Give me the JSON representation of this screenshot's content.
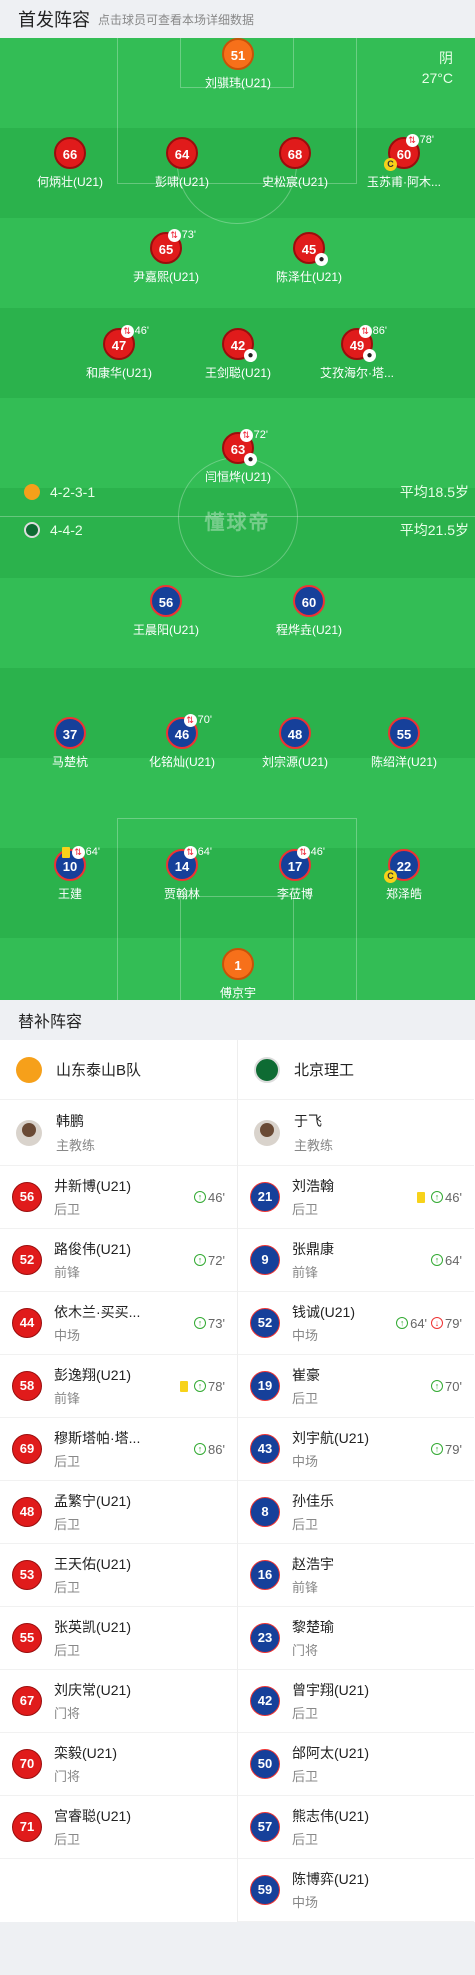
{
  "starting": {
    "title": "首发阵容",
    "subtitle": "点击球员可查看本场详细数据",
    "weather": "阴",
    "temp": "27°C",
    "watermark": "懂球帝"
  },
  "home_team": {
    "formation": "4-2-3-1",
    "avg_age": "平均18.5岁"
  },
  "away_team": {
    "formation": "4-4-2",
    "avg_age": "平均21.5岁"
  },
  "pitch_home": [
    {
      "num": "51",
      "name": "刘骐玮(U21)"
    },
    {
      "num": "66",
      "name": "何炳壮(U21)"
    },
    {
      "num": "64",
      "name": "彭啸(U21)"
    },
    {
      "num": "68",
      "name": "史松宸(U21)"
    },
    {
      "num": "60",
      "name": "玉苏甫·阿木...",
      "sub": "78'",
      "cap": true
    },
    {
      "num": "65",
      "name": "尹嘉熙(U21)",
      "sub": "73'"
    },
    {
      "num": "45",
      "name": "陈泽仕(U21)",
      "ball": true
    },
    {
      "num": "47",
      "name": "和康华(U21)",
      "sub": "46'"
    },
    {
      "num": "42",
      "name": "王剑聪(U21)",
      "ball": true
    },
    {
      "num": "49",
      "name": "艾孜海尔·塔...",
      "sub": "86'",
      "ball": true
    },
    {
      "num": "63",
      "name": "闫恒烨(U21)",
      "sub": "72'",
      "ball": true
    }
  ],
  "pitch_away": [
    {
      "num": "56",
      "name": "王晨阳(U21)"
    },
    {
      "num": "60",
      "name": "程烨垚(U21)"
    },
    {
      "num": "37",
      "name": "马楚杭"
    },
    {
      "num": "46",
      "name": "化铭灿(U21)",
      "sub": "70'"
    },
    {
      "num": "48",
      "name": "刘宗源(U21)"
    },
    {
      "num": "55",
      "name": "陈绍洋(U21)"
    },
    {
      "num": "10",
      "name": "王建",
      "sub": "64'",
      "ycard": true
    },
    {
      "num": "14",
      "name": "贾翰林",
      "sub": "64'"
    },
    {
      "num": "17",
      "name": "李莅博",
      "sub": "46'"
    },
    {
      "num": "22",
      "name": "郑泽皓",
      "cap": true
    },
    {
      "num": "1",
      "name": "傅京宇"
    }
  ],
  "bench": {
    "title": "替补阵容",
    "home": {
      "team": "山东泰山B队",
      "coach": "韩鹏",
      "coach_role": "主教练",
      "players": [
        {
          "num": "56",
          "name": "井新博(U21)",
          "pos": "后卫",
          "in": "46'"
        },
        {
          "num": "52",
          "name": "路俊伟(U21)",
          "pos": "前锋",
          "in": "72'"
        },
        {
          "num": "44",
          "name": "依木兰·买买...",
          "pos": "中场",
          "in": "73'"
        },
        {
          "num": "58",
          "name": "彭逸翔(U21)",
          "pos": "前锋",
          "in": "78'",
          "ycard": true
        },
        {
          "num": "69",
          "name": "穆斯塔帕·塔...",
          "pos": "后卫",
          "in": "86'"
        },
        {
          "num": "48",
          "name": "孟繁宁(U21)",
          "pos": "后卫"
        },
        {
          "num": "53",
          "name": "王天佑(U21)",
          "pos": "后卫"
        },
        {
          "num": "55",
          "name": "张英凯(U21)",
          "pos": "后卫"
        },
        {
          "num": "67",
          "name": "刘庆常(U21)",
          "pos": "门将"
        },
        {
          "num": "70",
          "name": "栾毅(U21)",
          "pos": "门将"
        },
        {
          "num": "71",
          "name": "宫睿聪(U21)",
          "pos": "后卫"
        }
      ]
    },
    "away": {
      "team": "北京理工",
      "coach": "于飞",
      "coach_role": "主教练",
      "players": [
        {
          "num": "21",
          "name": "刘浩翰",
          "pos": "后卫",
          "in": "46'",
          "ycard": true
        },
        {
          "num": "9",
          "name": "张鼎康",
          "pos": "前锋",
          "in": "64'"
        },
        {
          "num": "52",
          "name": "钱诚(U21)",
          "pos": "中场",
          "in": "64'",
          "out": "79'"
        },
        {
          "num": "19",
          "name": "崔豪",
          "pos": "后卫",
          "in": "70'"
        },
        {
          "num": "43",
          "name": "刘宇航(U21)",
          "pos": "中场",
          "in": "79'"
        },
        {
          "num": "8",
          "name": "孙佳乐",
          "pos": "后卫"
        },
        {
          "num": "16",
          "name": "赵浩宇",
          "pos": "前锋"
        },
        {
          "num": "23",
          "name": "黎楚瑜",
          "pos": "门将"
        },
        {
          "num": "42",
          "name": "曾宇翔(U21)",
          "pos": "后卫"
        },
        {
          "num": "50",
          "name": "邰阿太(U21)",
          "pos": "后卫"
        },
        {
          "num": "57",
          "name": "熊志伟(U21)",
          "pos": "后卫"
        },
        {
          "num": "59",
          "name": "陈博弈(U21)",
          "pos": "中场"
        }
      ]
    }
  },
  "colors": {
    "pitch": "#2bb24c",
    "home": "#e01b1b",
    "away": "#16409a",
    "keeper": "#f7701a"
  }
}
